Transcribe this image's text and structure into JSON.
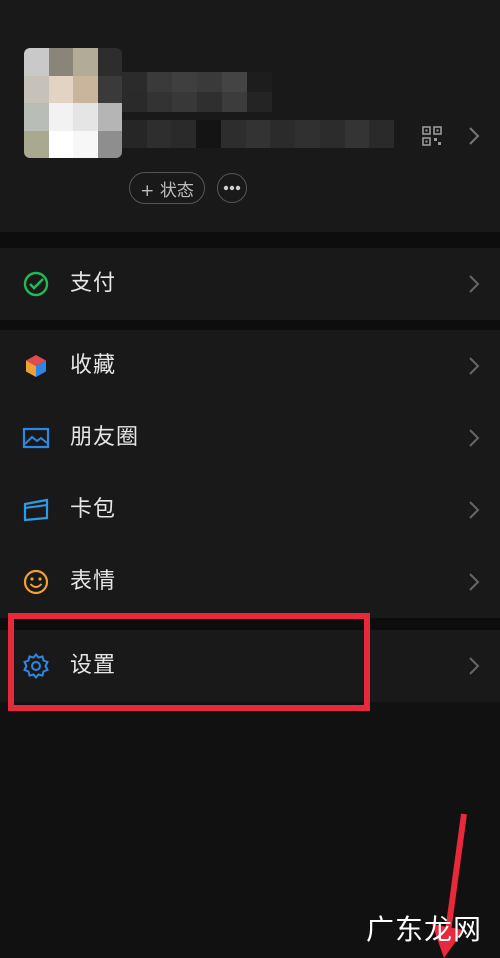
{
  "profile": {
    "status_label": "+ 状态",
    "more_label": "•••",
    "avatar_colors": [
      "#c9c9c9",
      "#8a8579",
      "#b1ab98",
      "#2d2d2d",
      "#c7c2b9",
      "#e3d3c3",
      "#c9b59c",
      "#3a3a3a",
      "#b9bdb8",
      "#f2f2f2",
      "#e5e5e5",
      "#b5b5b5",
      "#a9a98f",
      "#ffffff",
      "#f7f7f7",
      "#8e8e8e"
    ]
  },
  "menu": {
    "pay": {
      "label": "支付",
      "icon": "wechat-pay-icon",
      "color": "#1fbb54"
    },
    "favorites": {
      "label": "收藏",
      "icon": "favorites-cube-icon"
    },
    "moments": {
      "label": "朋友圈",
      "icon": "moments-photo-icon",
      "color": "#2c87e6"
    },
    "cards": {
      "label": "卡包",
      "icon": "card-wallet-icon",
      "color": "#2c9be6"
    },
    "stickers": {
      "label": "表情",
      "icon": "smiley-icon",
      "color": "#f0a035"
    },
    "settings": {
      "label": "设置",
      "icon": "gear-icon",
      "color": "#2c87e6"
    }
  },
  "annotation": {
    "highlight_color": "#e8283b"
  },
  "watermark": "广东龙网"
}
